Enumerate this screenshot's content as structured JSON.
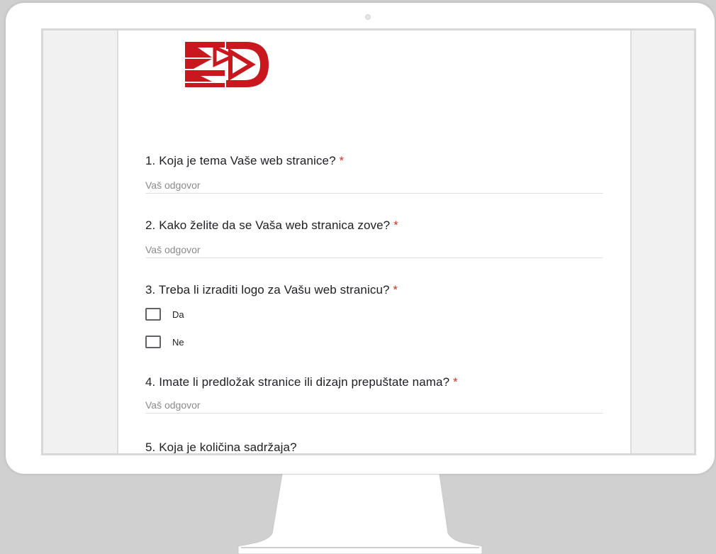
{
  "form": {
    "questions": [
      {
        "number_text": "1. Koja je tema Vaše web stranice?",
        "required_mark": "*",
        "answer_placeholder": "Vaš odgovor"
      },
      {
        "number_text": "2. Kako želite da se Vaša web stranica zove?",
        "required_mark": "*",
        "answer_placeholder": "Vaš odgovor"
      },
      {
        "number_text": "3. Treba li izraditi logo za Vašu web stranicu?",
        "required_mark": "*",
        "options": [
          "Da",
          "Ne"
        ]
      },
      {
        "number_text": "4. Imate li predložak stranice ili dizajn prepuštate nama?",
        "required_mark": "*",
        "answer_placeholder": "Vaš odgovor"
      },
      {
        "number_text": "5. Koja je količina sadržaja?"
      }
    ]
  },
  "logo": {
    "color": "#c8181e",
    "icon": "dd-crown-logo"
  }
}
